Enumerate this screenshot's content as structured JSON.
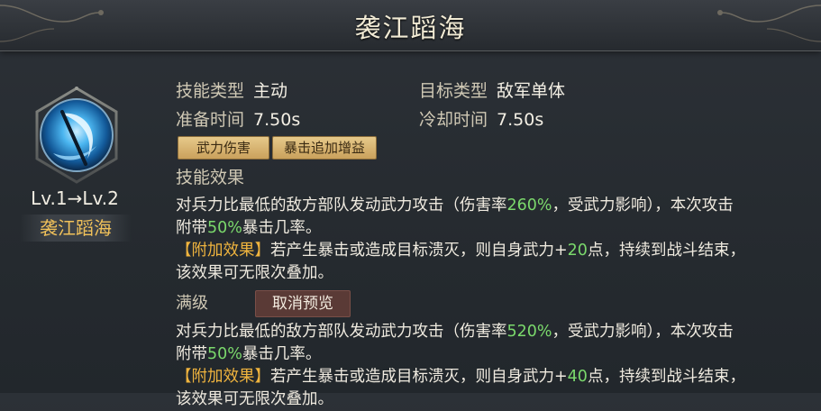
{
  "title": "袭江蹈海",
  "skill": {
    "level_text": "Lv.1→Lv.2",
    "name": "袭江蹈海",
    "icon": "crescent-blade-icon"
  },
  "info": {
    "skill_type_label": "技能类型",
    "skill_type_value": "主动",
    "target_type_label": "目标类型",
    "target_type_value": "敌军单体",
    "prep_time_label": "准备时间",
    "prep_time_value": "7.50s",
    "cooldown_label": "冷却时间",
    "cooldown_value": "7.50s"
  },
  "tags": [
    "武力伤害",
    "暴击追加增益"
  ],
  "effect_title": "技能效果",
  "effect": {
    "line1_pre": "对兵力比最低的敌方部队发动武力攻击（伤害率",
    "line1_pct": "260%",
    "line1_post": "，受武力影响），本次攻击",
    "line2_pre": "附带",
    "line2_pct": "50%",
    "line2_post": "暴击几率。",
    "extra_tag": "【附加效果】",
    "line3_pre": "若产生暴击或造成目标溃灭，则自身武力+",
    "line3_num": "20",
    "line3_post": "点，持续到战斗结束，",
    "line4": "该效果可无限次叠加。"
  },
  "max_level": {
    "label": "满级",
    "cancel_button": "取消预览",
    "line1_pre": "对兵力比最低的敌方部队发动武力攻击（伤害率",
    "line1_pct": "520%",
    "line1_post": "，受武力影响），本次攻击",
    "line2_pre": "附带",
    "line2_pct": "50%",
    "line2_post": "暴击几率。",
    "extra_tag": "【附加效果】",
    "line3_pre": "若产生暴击或造成目标溃灭，则自身武力+",
    "line3_num": "40",
    "line3_post": "点，持续到战斗结束，",
    "line4": "该效果可无限次叠加。"
  },
  "colors": {
    "highlight_green": "#7bd96c",
    "highlight_orange": "#f0b43e",
    "name_gold": "#f0c15a"
  }
}
